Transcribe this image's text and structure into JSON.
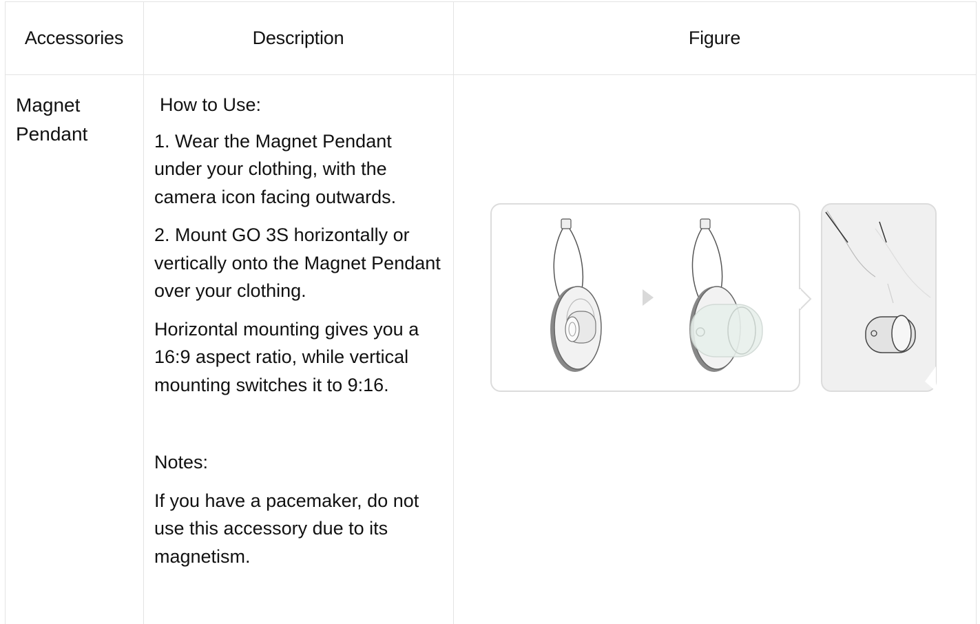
{
  "headers": {
    "accessories": "Accessories",
    "description": "Description",
    "figure": "Figure"
  },
  "row": {
    "accessory": "Magnet Pendant",
    "how_to_title": "How to Use:",
    "step1": "1. Wear the Magnet Pendant under your clothing, with the camera icon facing outwards.",
    "step2": "2. Mount GO 3S horizontally or vertically onto the Magnet Pendant over your clothing.",
    "note_aspect": "Horizontal mounting gives you a 16:9 aspect ratio, while vertical mounting switches it to 9:16.",
    "notes_title": "Notes:",
    "notes_text": "If you have a pacemaker, do not use this accessory due to its magnetism."
  },
  "figure": {
    "icons": [
      "magnet-pendant-illustration",
      "arrow-right-icon",
      "camera-mounted-pendant-illustration",
      "worn-pendant-illustration"
    ]
  }
}
